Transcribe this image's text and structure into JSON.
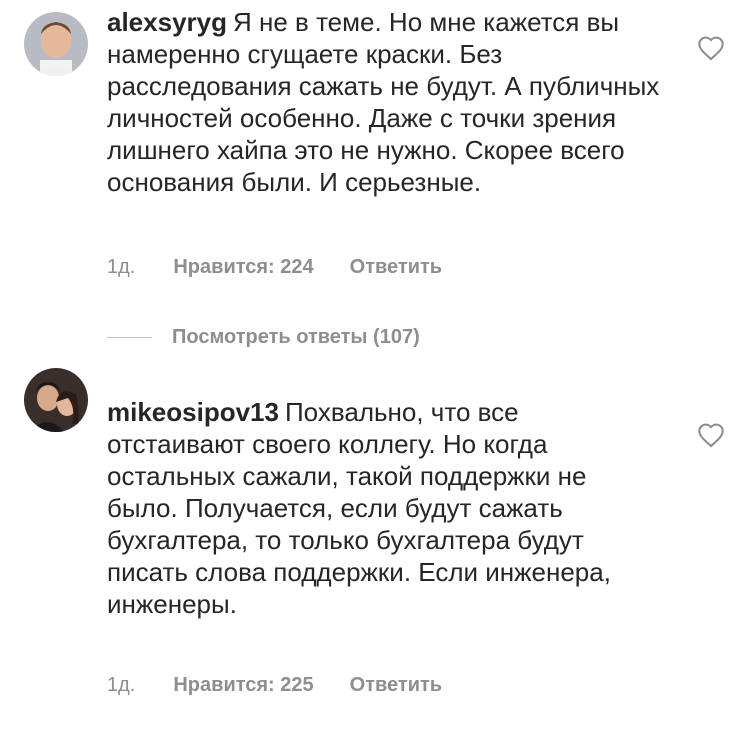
{
  "comments": [
    {
      "username": "alexsyryg",
      "text": "Я не в теме. Но мне кажется вы намеренно сгущаете краски. Без расследования сажать не будут. А публичных личностей особенно. Даже с точки зрения  лишнего хайпа это не нужно. Скорее всего основания были. И серьезные.",
      "time": "1д.",
      "likes": "Нравится: 224",
      "reply": "Ответить",
      "view_replies": "Посмотреть ответы (107)"
    },
    {
      "username": "mikeosipov13",
      "text": "Похвально, что все отстаивают своего коллегу. Но когда остальных сажали, такой поддержки не было. Получается, если будут сажать бухгалтера, то только бухгалтера будут писать слова поддержки. Если инженера, инженеры.",
      "time": "1д.",
      "likes": "Нравится: 225",
      "reply": "Ответить"
    }
  ],
  "icons": {
    "like": "heart-outline-icon"
  },
  "colors": {
    "text": "#262626",
    "secondary": "#8e8e8e",
    "divider": "#c7c7c7"
  }
}
